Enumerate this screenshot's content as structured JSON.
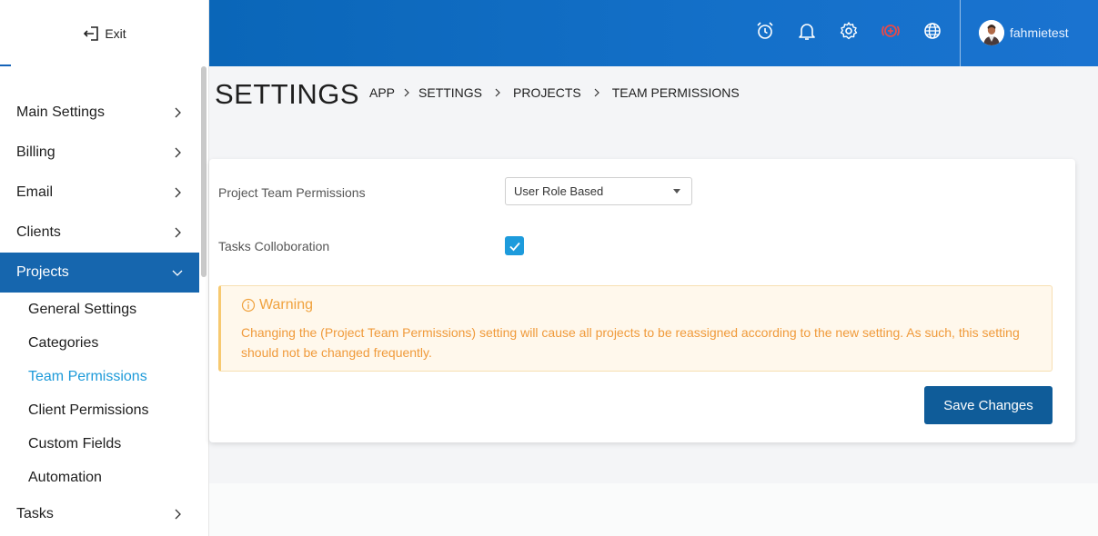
{
  "sidebar": {
    "exit_label": "Exit",
    "items": [
      {
        "label": "Main Settings"
      },
      {
        "label": "Billing"
      },
      {
        "label": "Email"
      },
      {
        "label": "Clients"
      },
      {
        "label": "Projects"
      }
    ],
    "projects_sub": [
      {
        "label": "General Settings"
      },
      {
        "label": "Categories"
      },
      {
        "label": "Team Permissions"
      },
      {
        "label": "Client Permissions"
      },
      {
        "label": "Custom Fields"
      },
      {
        "label": "Automation"
      }
    ],
    "tasks_label": "Tasks",
    "active_item": "Projects",
    "selected_sub": "Team Permissions"
  },
  "header": {
    "icons": [
      "alarm-clock-icon",
      "bell-icon",
      "gear-icon",
      "record-add-icon",
      "globe-icon"
    ],
    "username": "fahmietest"
  },
  "page": {
    "title": "SETTINGS",
    "breadcrumb": [
      "APP",
      "SETTINGS",
      "PROJECTS",
      "TEAM PERMISSIONS"
    ]
  },
  "form": {
    "team_permissions_label": "Project Team Permissions",
    "team_permissions_value": "User Role Based",
    "tasks_collab_label": "Tasks Colloboration",
    "tasks_collab_checked": true,
    "warning_title": "Warning",
    "warning_text": "Changing the (Project Team Permissions) setting will cause all projects to be reassigned according to the new setting. As such, this setting should not be changed frequently.",
    "save_label": "Save Changes"
  },
  "colors": {
    "header_blue": "#1470c9",
    "active_nav": "#1666ae",
    "selected_sub": "#1d9ad9",
    "warning_orange": "#f09a3a",
    "save_button": "#0f5c99",
    "record_icon_red": "#e64a4a"
  }
}
